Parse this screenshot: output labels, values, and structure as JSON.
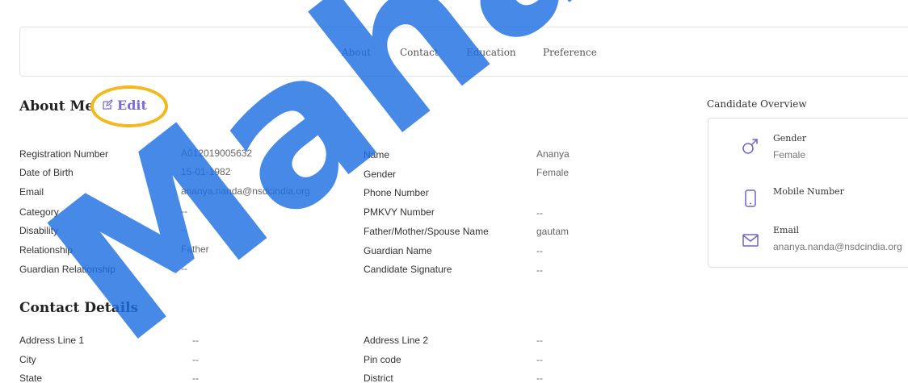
{
  "tabs": [
    {
      "label": "About"
    },
    {
      "label": "Contact"
    },
    {
      "label": "Education"
    },
    {
      "label": "Preference"
    }
  ],
  "about": {
    "heading": "About Me",
    "edit_label": "Edit",
    "left_fields": [
      {
        "label": "Registration Number",
        "value": "A012019005632"
      },
      {
        "label": "Date of Birth",
        "value": "15-01-1982"
      },
      {
        "label": "Email",
        "value": "ananya.nanda@nsdcindia.org"
      },
      {
        "label": "Category",
        "value": "--"
      },
      {
        "label": "Disability",
        "value": "--"
      },
      {
        "label": "Relationship",
        "value": "Father"
      },
      {
        "label": "Guardian Relationship",
        "value": "--"
      }
    ],
    "right_fields": [
      {
        "label": "Name",
        "value": "Ananya"
      },
      {
        "label": "Gender",
        "value": "Female"
      },
      {
        "label": "Phone Number",
        "value": ""
      },
      {
        "label": "PMKVY Number",
        "value": "--"
      },
      {
        "label": "Father/Mother/Spouse Name",
        "value": "gautam"
      },
      {
        "label": "Guardian Name",
        "value": "--"
      },
      {
        "label": "Candidate Signature",
        "value": "--"
      }
    ]
  },
  "contact": {
    "heading": "Contact Details",
    "left_fields": [
      {
        "label": "Address Line 1",
        "value": "--"
      },
      {
        "label": "City",
        "value": "--"
      },
      {
        "label": "State",
        "value": "--"
      }
    ],
    "right_fields": [
      {
        "label": "Address Line 2",
        "value": "--"
      },
      {
        "label": "Pin code",
        "value": "--"
      },
      {
        "label": "District",
        "value": "--"
      }
    ]
  },
  "overview": {
    "title": "Candidate Overview",
    "items": [
      {
        "label": "Gender",
        "value": "Female",
        "icon": "male-gender-icon"
      },
      {
        "label": "Mobile Number",
        "value": "",
        "icon": "mobile-phone-icon"
      },
      {
        "label": "Email",
        "value": "ananya.nanda@nsdcindia.org",
        "icon": "envelope-icon"
      }
    ]
  },
  "watermark": {
    "text": "Maha"
  },
  "colors": {
    "accent": "#7b6ad8",
    "highlight": "#f3b81e",
    "watermark": "#1f6fe0"
  }
}
